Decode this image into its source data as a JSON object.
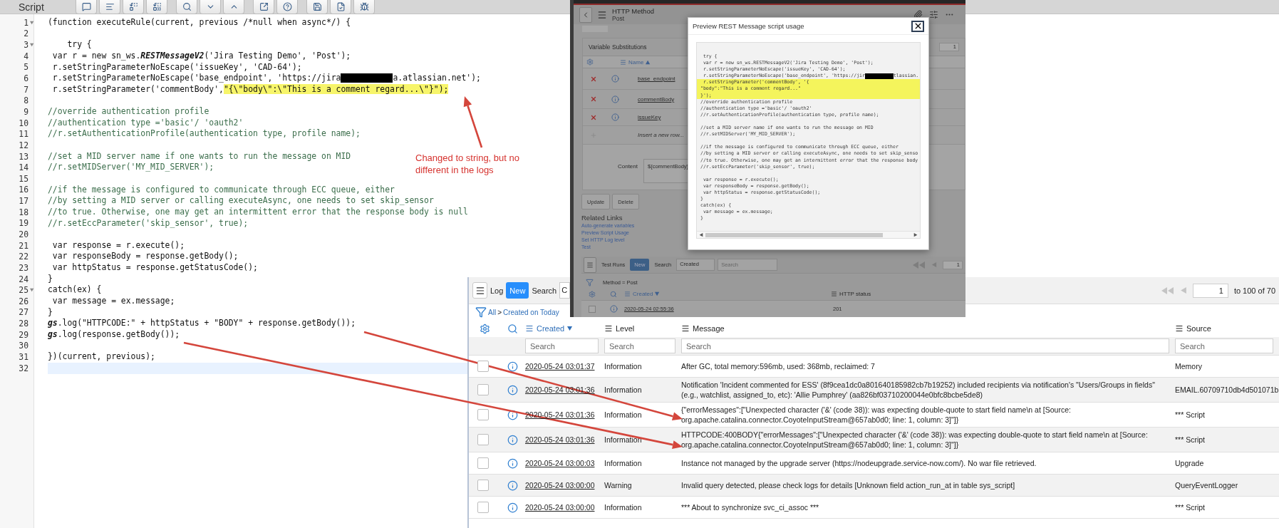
{
  "editor": {
    "title": "Script",
    "lines": [
      {
        "number": "1",
        "kind": "code",
        "text": "(function executeRule(current, previous /*null when async*/) {",
        "fold": true,
        "active": false
      },
      {
        "number": "2",
        "kind": "code",
        "fold": false,
        "active": false
      },
      {
        "number": "3",
        "kind": "code",
        "text": "    try {",
        "fold": true,
        "active": false
      },
      {
        "number": "4",
        "kind": "code",
        "segments": [
          {
            "kind": "plain",
            "text": " var r = new sn_ws."
          },
          {
            "kind": "emphasis",
            "text": "RESTMessageV2"
          },
          {
            "kind": "plain",
            "text": "('Jira Testing Demo', 'Post');"
          }
        ],
        "fold": false,
        "active": false
      },
      {
        "number": "5",
        "kind": "code",
        "text": " r.setStringParameterNoEscape('issueKey', 'CAD-64');",
        "fold": false,
        "active": false
      },
      {
        "number": "6",
        "kind": "code",
        "segments": [
          {
            "kind": "plain",
            "text": " r.setStringParameterNoEscape('base_endpoint', 'https://jira"
          },
          {
            "kind": "redaction"
          },
          {
            "kind": "plain",
            "text": "a.atlassian.net');"
          }
        ],
        "fold": false,
        "active": false
      },
      {
        "number": "7",
        "kind": "code",
        "segments": [
          {
            "kind": "plain",
            "text": " r.setStringParameter('commentBody',"
          },
          {
            "kind": "highlight",
            "text": "\"{\\\"body\\\":\\\"This is a comment regard...\\\"}\");"
          }
        ],
        "fold": false,
        "active": false
      },
      {
        "number": "8",
        "kind": "code",
        "fold": false,
        "active": false
      },
      {
        "number": "9",
        "kind": "comment",
        "text": "//override authentication profile",
        "fold": false,
        "active": false
      },
      {
        "number": "10",
        "kind": "comment",
        "text": "//authentication type ='basic'/ 'oauth2'",
        "fold": false,
        "active": false
      },
      {
        "number": "11",
        "kind": "comment",
        "text": "//r.setAuthenticationProfile(authentication type, profile name);",
        "fold": false,
        "active": false
      },
      {
        "number": "12",
        "kind": "code",
        "fold": false,
        "active": false
      },
      {
        "number": "13",
        "kind": "comment",
        "text": "//set a MID server name if one wants to run the message on MID",
        "fold": false,
        "active": false
      },
      {
        "number": "14",
        "kind": "comment",
        "text": "//r.setMIDServer('MY_MID_SERVER');",
        "fold": false,
        "active": false
      },
      {
        "number": "15",
        "kind": "code",
        "fold": false,
        "active": false
      },
      {
        "number": "16",
        "kind": "comment",
        "text": "//if the message is configured to communicate through ECC queue, either",
        "fold": false,
        "active": false
      },
      {
        "number": "17",
        "kind": "comment",
        "text": "//by setting a MID server or calling executeAsync, one needs to set skip_sensor",
        "fold": false,
        "active": false
      },
      {
        "number": "18",
        "kind": "comment",
        "text": "//to true. Otherwise, one may get an intermittent error that the response body is null",
        "fold": false,
        "active": false
      },
      {
        "number": "19",
        "kind": "comment",
        "text": "//r.setEccParameter('skip_sensor', true);",
        "fold": false,
        "active": false
      },
      {
        "number": "20",
        "kind": "code",
        "fold": false,
        "active": false
      },
      {
        "number": "21",
        "kind": "code",
        "text": " var response = r.execute();",
        "fold": false,
        "active": false
      },
      {
        "number": "22",
        "kind": "code",
        "text": " var responseBody = response.getBody();",
        "fold": false,
        "active": false
      },
      {
        "number": "23",
        "kind": "code",
        "text": " var httpStatus = response.getStatusCode();",
        "fold": false,
        "active": false
      },
      {
        "number": "24",
        "kind": "code",
        "text": "}",
        "fold": false,
        "active": false
      },
      {
        "number": "25",
        "kind": "code",
        "text": "catch(ex) {",
        "fold": true,
        "active": false
      },
      {
        "number": "26",
        "kind": "code",
        "text": " var message = ex.message;",
        "fold": false,
        "active": false
      },
      {
        "number": "27",
        "kind": "code",
        "text": "}",
        "fold": false,
        "active": false
      },
      {
        "number": "28",
        "kind": "code",
        "segments": [
          {
            "kind": "emphasis",
            "text": "gs"
          },
          {
            "kind": "plain",
            "text": ".log(\"HTTPCODE:\" + httpStatus + \"BODY\" + response.getBody());"
          }
        ],
        "fold": false,
        "active": false
      },
      {
        "number": "29",
        "kind": "code",
        "segments": [
          {
            "kind": "emphasis",
            "text": "gs"
          },
          {
            "kind": "plain",
            "text": ".log(response.getBody());"
          }
        ],
        "fold": false,
        "active": false
      },
      {
        "number": "30",
        "kind": "code",
        "fold": false,
        "active": false
      },
      {
        "number": "31",
        "kind": "code",
        "text": "})(current, previous);",
        "fold": false,
        "active": false
      },
      {
        "number": "32",
        "kind": "code",
        "fold": false,
        "active": true
      }
    ]
  },
  "annotation": {
    "text": "Changed to string, but no different in the logs"
  },
  "http_method": {
    "title": "HTTP Method",
    "subtitle": "Post",
    "variables": {
      "title": "Variable Substitutions",
      "page": "1",
      "column": "Name",
      "rows": [
        "base_endpoint",
        "commentBody",
        "issueKey"
      ],
      "insert": "Insert a new row..."
    },
    "content": {
      "label": "Content",
      "value": "${commentBody}"
    },
    "buttons": [
      "Update",
      "Delete"
    ],
    "related": {
      "title": "Related Links",
      "links": [
        "Auto-generate variables",
        "Preview Script Usage",
        "Set HTTP Log level",
        "Test"
      ]
    },
    "test_runs": {
      "title": "Test Runs",
      "new_button": "New",
      "search_label": "Search",
      "field": "Created",
      "placeholder": "Search",
      "page": "1",
      "filter": "Method = Post",
      "columns": [
        "Created",
        "HTTP status"
      ],
      "rows": [
        {
          "created": "2020-05-24 02:55:36",
          "status": "201",
          "checked": false
        }
      ]
    }
  },
  "modal": {
    "title": "Preview REST Message script usage",
    "lines": [
      {
        "text": " try {",
        "highlighted": false
      },
      {
        "text": " var r = new sn_ws.RESTMessageV2('Jira Testing Demo', 'Post');",
        "highlighted": false
      },
      {
        "text": " r.setStringParameterNoEscape('issueKey', 'CAD-64');",
        "highlighted": false
      },
      {
        "segments": [
          {
            "kind": "plain",
            "text": " r.setStringParameterNoEscape('base_endpoint', 'https://jir"
          },
          {
            "kind": "redaction"
          },
          {
            "kind": "plain",
            "text": "tlassian."
          }
        ],
        "highlighted": false
      },
      {
        "text": " r.setStringParameter('commentBody', '{",
        "highlighted": true
      },
      {
        "text": "\"body\":\"This is a comment regard...\"",
        "highlighted": true
      },
      {
        "text": "}');",
        "highlighted": true
      },
      {
        "text": "//override authentication profile",
        "highlighted": false
      },
      {
        "text": "//authentication type ='basic'/ 'oauth2'",
        "highlighted": false
      },
      {
        "text": "//r.setAuthenticationProfile(authentication type, profile name);",
        "highlighted": false
      },
      {
        "highlighted": false
      },
      {
        "text": "//set a MID server name if one wants to run the message on MID",
        "highlighted": false
      },
      {
        "text": "//r.setMIDServer('MY_MID_SERVER');",
        "highlighted": false
      },
      {
        "highlighted": false
      },
      {
        "text": "//if the message is configured to communicate through ECC queue, either",
        "highlighted": false
      },
      {
        "text": "//by setting a MID server or calling executeAsync, one needs to set skip_senso",
        "highlighted": false
      },
      {
        "text": "//to true. Otherwise, one may get an intermittent error that the response body",
        "highlighted": false
      },
      {
        "text": "//r.setEccParameter('skip_sensor', true);",
        "highlighted": false
      },
      {
        "highlighted": false
      },
      {
        "text": " var response = r.execute();",
        "highlighted": false
      },
      {
        "text": " var responseBody = response.getBody();",
        "highlighted": false
      },
      {
        "text": " var httpStatus = response.getStatusCode();",
        "highlighted": false
      },
      {
        "text": "}",
        "highlighted": false
      },
      {
        "text": "catch(ex) {",
        "highlighted": false
      },
      {
        "text": " var message = ex.message;",
        "highlighted": false
      },
      {
        "text": "}",
        "highlighted": false
      }
    ]
  },
  "log_list": {
    "title": "Log",
    "new_button": "New",
    "search_label": "Search",
    "search_field": "C",
    "page": "1",
    "page_range": "to 100 of 70",
    "breadcrumb": {
      "root": "All",
      "separator": ">",
      "filter": "Created on Today"
    },
    "columns": [
      {
        "label": "Created",
        "sorted": true
      },
      {
        "label": "Level",
        "sorted": false
      },
      {
        "label": "Message",
        "sorted": false
      },
      {
        "label": "Source",
        "sorted": false
      }
    ],
    "search_placeholders": [
      "Search",
      "Search",
      "Search",
      "Search"
    ],
    "rows": [
      {
        "created": "2020-05-24 03:01:37",
        "level": "Information",
        "message": "After GC, total memory:596mb, used: 368mb, reclaimed: 7",
        "source": "Memory",
        "checked": false
      },
      {
        "created": "2020-05-24 03:01:36",
        "level": "Information",
        "message": "Notification 'Incident commented for ESS' (8f9cea1dc0a801640185982cb7b19252) included recipients via notification's \"Users/Groups in fields\" (e.g., watchlist, assigned_to, etc): 'Allie Pumphrey' (aa826bf03710200044e0bfc8bcbe5de8)",
        "source": "EMAIL.60709710db4d501071b",
        "checked": false
      },
      {
        "created": "2020-05-24 03:01:36",
        "level": "Information",
        "message": "{\"errorMessages\":[\"Unexpected character ('&' (code 38)): was expecting double-quote to start field name\\n at [Source: org.apache.catalina.connector.CoyoteInputStream@657ab0d0; line: 1, column: 3]\"]}",
        "source": "*** Script",
        "checked": false
      },
      {
        "created": "2020-05-24 03:01:36",
        "level": "Information",
        "message": "HTTPCODE:400BODY{\"errorMessages\":[\"Unexpected character ('&' (code 38)): was expecting double-quote to start field name\\n at [Source: org.apache.catalina.connector.CoyoteInputStream@657ab0d0; line: 1, column: 3]\"]}",
        "source": "*** Script",
        "checked": false
      },
      {
        "created": "2020-05-24 03:00:03",
        "level": "Information",
        "message": "Instance not managed by the upgrade server (https://nodeupgrade.service-now.com/). No war file retrieved.",
        "source": "Upgrade",
        "checked": false
      },
      {
        "created": "2020-05-24 03:00:00",
        "level": "Warning",
        "message": "Invalid query detected, please check logs for details [Unknown field action_run_at in table sys_script]",
        "source": "QueryEventLogger",
        "checked": false
      },
      {
        "created": "2020-05-24 03:00:00",
        "level": "Information",
        "message": "*** About to synchronize svc_ci_assoc ***",
        "source": "*** Script",
        "checked": false
      }
    ]
  }
}
